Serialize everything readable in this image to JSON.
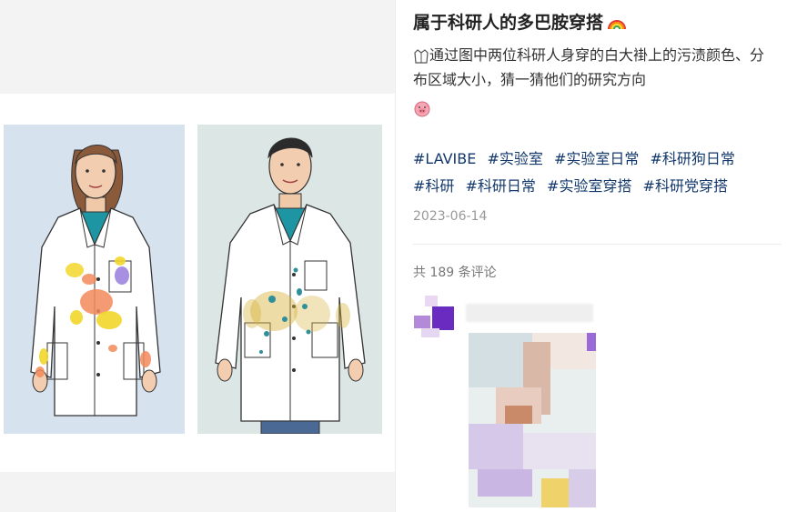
{
  "post": {
    "title": "属于科研人的多巴胺穿搭",
    "title_emoji": "rainbow-icon",
    "description": "通过图中两位科研人身穿的白大褂上的污渍颜色、分布区域大小，猜一猜他们的研究方向",
    "description_lead_icon": "lab-coat-icon",
    "description_trail_icon": "pig-face-icon",
    "tags": [
      "#LAVIBE",
      "#实验室",
      "#实验室日常",
      "#科研狗日常",
      "#科研",
      "#科研日常",
      "#实验室穿搭",
      "#科研党穿搭"
    ],
    "date": "2023-06-14"
  },
  "comments": {
    "count_label": "共 189 条评论"
  },
  "colors": {
    "tag": "#13386c",
    "panel_left_bg": "#d7e2ef",
    "panel_right_bg": "#dbe6e5",
    "stain_orange": "#f28a5a",
    "stain_yellow": "#f2d62a",
    "stain_purple": "#8a6ad8",
    "stain_teal": "#2f8f9a",
    "stain_mustard": "#d8b23a"
  }
}
